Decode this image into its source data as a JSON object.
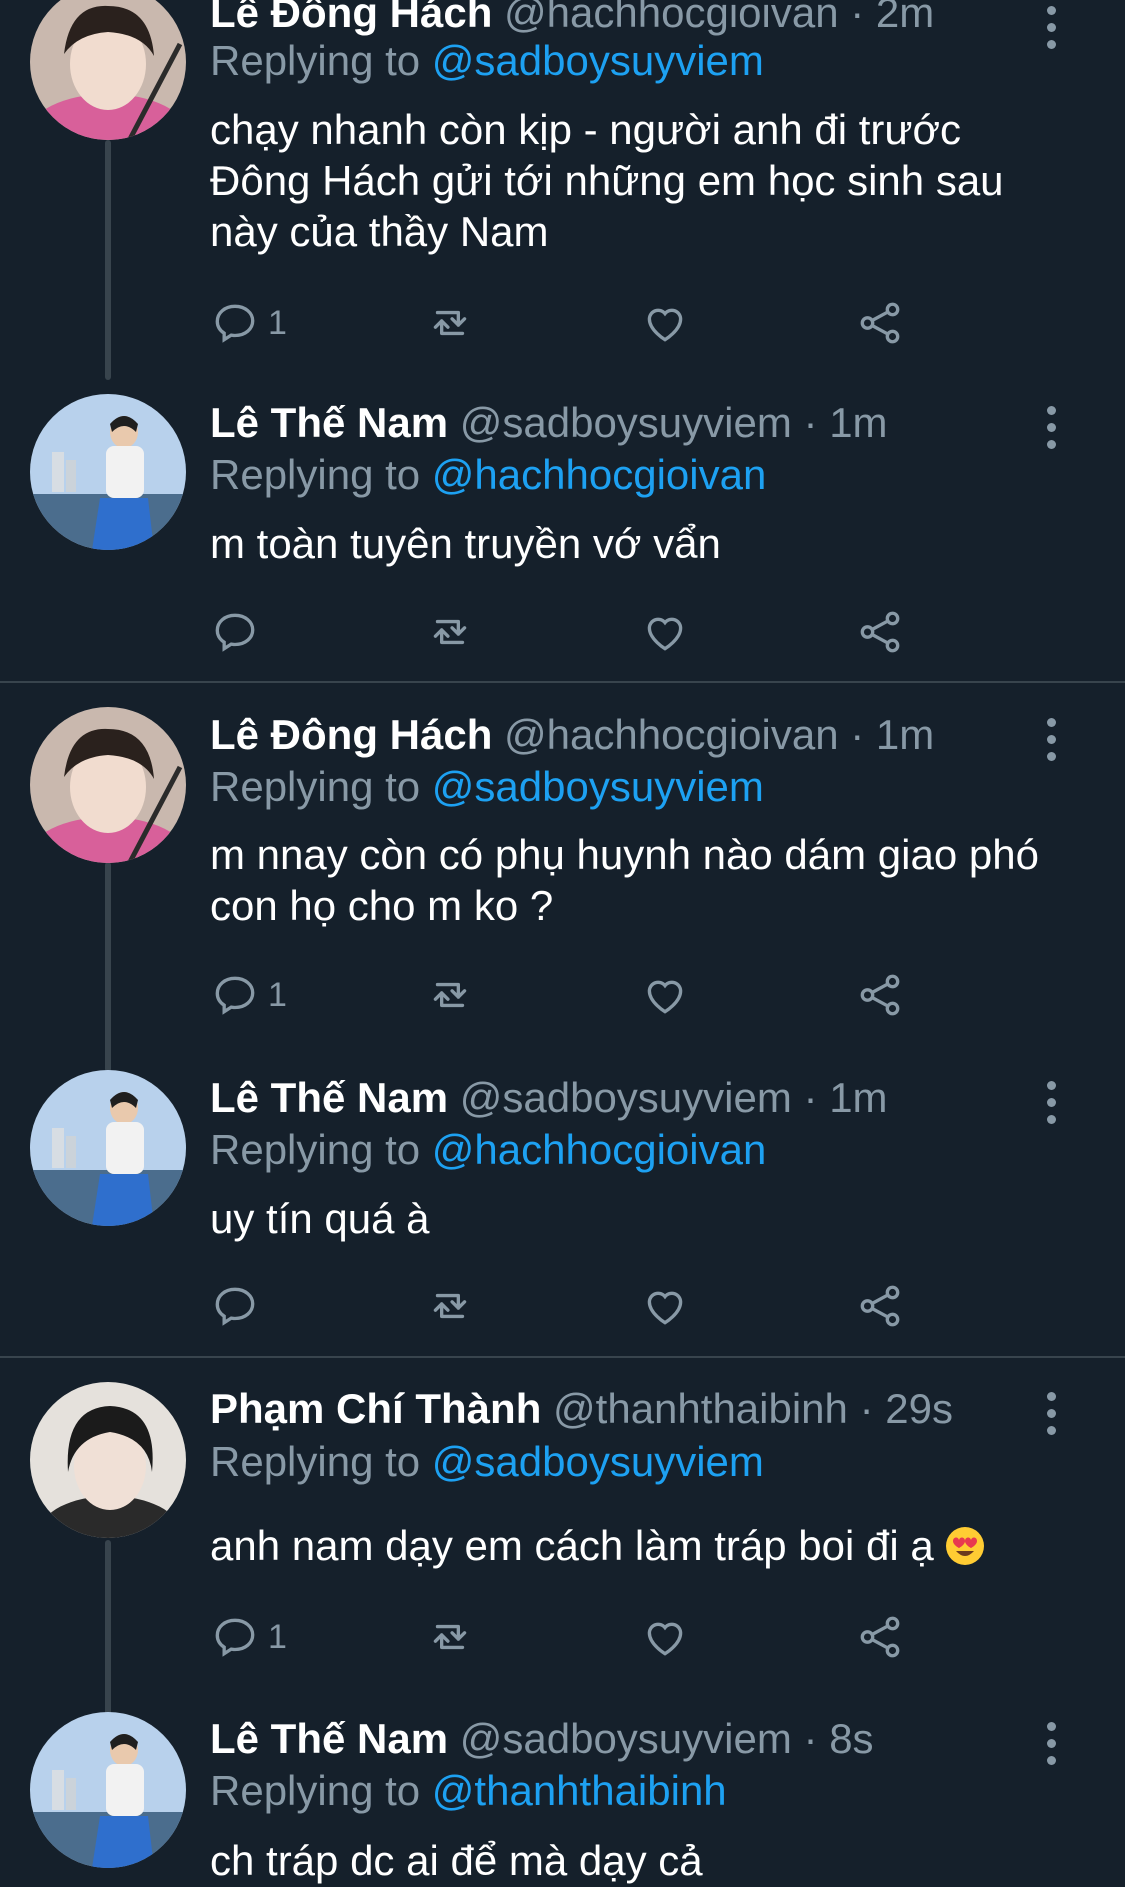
{
  "tweets": [
    {
      "name": "Lê Đông Hách",
      "handle": "@hachhocgioivan",
      "dot": "·",
      "time": "2m",
      "replying_prefix": "Replying to",
      "replying_to": "@sadboysuyviem",
      "text": "chạy nhanh còn kịp - người anh đi trước Đông Hách gửi tới những em học sinh sau này của thầy Nam",
      "reply_count": "1",
      "avatar": "hach"
    },
    {
      "name": "Lê Thế Nam",
      "handle": "@sadboysuyviem",
      "dot": "·",
      "time": "1m",
      "replying_prefix": "Replying to",
      "replying_to": "@hachhocgioivan",
      "text": "m toàn tuyên truyền vớ vẩn",
      "reply_count": "",
      "avatar": "nam"
    },
    {
      "name": "Lê Đông Hách",
      "handle": "@hachhocgioivan",
      "dot": "·",
      "time": "1m",
      "replying_prefix": "Replying to",
      "replying_to": "@sadboysuyviem",
      "text": "m nnay còn có phụ huynh nào dám giao phó con họ cho m ko ?",
      "reply_count": "1",
      "avatar": "hach"
    },
    {
      "name": "Lê Thế Nam",
      "handle": "@sadboysuyviem",
      "dot": "·",
      "time": "1m",
      "replying_prefix": "Replying to",
      "replying_to": "@hachhocgioivan",
      "text": "uy tín quá à",
      "reply_count": "",
      "avatar": "nam"
    },
    {
      "name": "Phạm Chí Thành",
      "handle": "@thanhthaibinh",
      "dot": "·",
      "time": "29s",
      "replying_prefix": "Replying to",
      "replying_to": "@sadboysuyviem",
      "text": "anh nam dạy em cách làm tráp boi đi ạ",
      "emoji": "heart-eyes",
      "reply_count": "1",
      "avatar": "thanh"
    },
    {
      "name": "Lê Thế Nam",
      "handle": "@sadboysuyviem",
      "dot": "·",
      "time": "8s",
      "replying_prefix": "Replying to",
      "replying_to": "@thanhthaibinh",
      "text": "ch tráp dc ai để mà dạy cả",
      "reply_count": "",
      "avatar": "nam"
    }
  ],
  "icons": {
    "reply": "reply-icon",
    "retweet": "retweet-icon",
    "like": "like-icon",
    "share": "share-icon",
    "more": "more-icon"
  },
  "colors": {
    "background": "#15202b",
    "muted": "#8899a6",
    "link": "#1da1f2",
    "divider": "#38444d"
  }
}
